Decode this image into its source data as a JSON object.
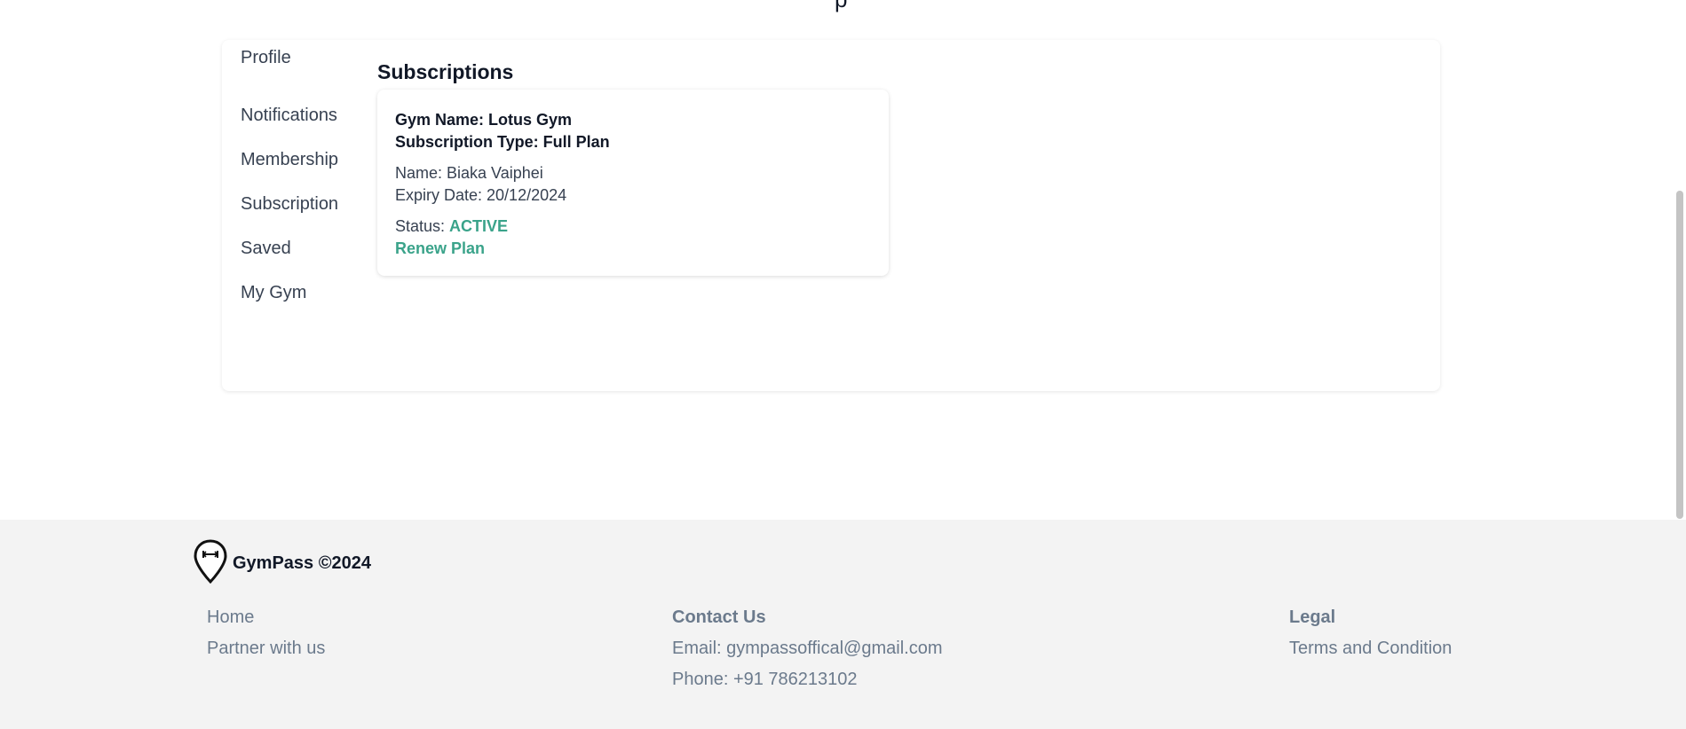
{
  "page": {
    "heading_fragment": "p"
  },
  "side_nav": {
    "items": [
      {
        "label": "Profile"
      },
      {
        "label": "Notifications"
      },
      {
        "label": "Membership"
      },
      {
        "label": "Subscription"
      },
      {
        "label": "Saved"
      },
      {
        "label": "My Gym"
      }
    ]
  },
  "subscriptions": {
    "title": "Subscriptions",
    "card": {
      "gym_name": "Gym Name: Lotus Gym",
      "subscription_type": "Subscription Type: Full Plan",
      "name": "Name: Biaka Vaiphei",
      "expiry": "Expiry Date: 20/12/2024",
      "status_label": "Status:",
      "status_value": "ACTIVE",
      "renew_label": "Renew Plan"
    }
  },
  "footer": {
    "brand": "GymPass ©2024",
    "nav_links": [
      "Home",
      "Partner with us"
    ],
    "contact": {
      "heading": "Contact Us",
      "email": "Email: gympassoffical@gmail.com",
      "phone": "Phone: +91 786213102"
    },
    "legal": {
      "heading": "Legal",
      "terms": "Terms and Condition"
    }
  },
  "colors": {
    "accent_green": "#3aa38a",
    "footer_bg": "#f3f3f3",
    "footer_text": "#6b7a8c"
  },
  "icons": {
    "brand_logo": "map-pin-dumbbell-icon"
  }
}
